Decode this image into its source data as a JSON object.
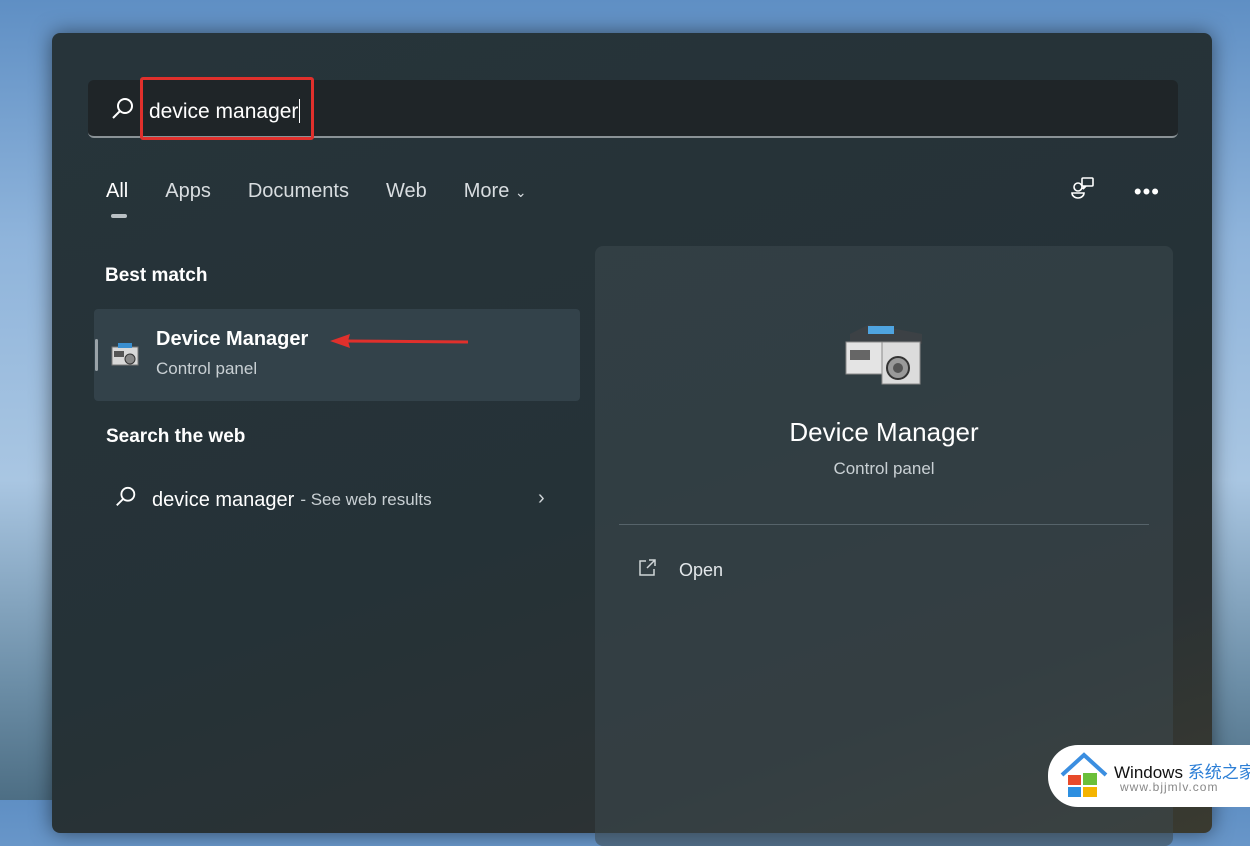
{
  "search": {
    "value": "device manager"
  },
  "tabs": [
    {
      "label": "All",
      "active": true
    },
    {
      "label": "Apps"
    },
    {
      "label": "Documents"
    },
    {
      "label": "Web"
    },
    {
      "label": "More"
    }
  ],
  "sections": {
    "best_match": "Best match",
    "search_web": "Search the web"
  },
  "best_match": {
    "title": "Device Manager",
    "subtitle": "Control panel",
    "icon": "device-manager-icon"
  },
  "web_result": {
    "query": "device manager",
    "suffix": "- See web results"
  },
  "preview": {
    "title": "Device Manager",
    "subtitle": "Control panel",
    "actions": [
      {
        "label": "Open",
        "icon": "open-external-icon"
      }
    ]
  },
  "annotation_color": "#e0302c",
  "watermark": {
    "brand": "Windows",
    "cn": "系统之家",
    "url": "www.bjjmlv.com"
  }
}
